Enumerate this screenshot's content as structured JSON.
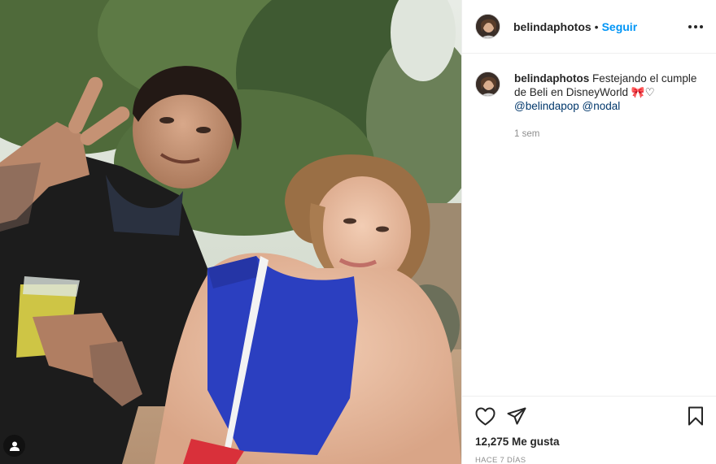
{
  "post": {
    "image_alt": "photo",
    "author": {
      "username": "belindaphotos",
      "separator": "•",
      "follow_label": "Seguir"
    }
  },
  "caption": {
    "username": "belindaphotos",
    "text": "Festejando el cumple de Beli en DisneyWorld 🎀♡",
    "mentions": [
      "@belindapop",
      "@nodal"
    ],
    "age": "1 sem"
  },
  "stats": {
    "likes": "12,275 Me gusta",
    "timestamp": "HACE 7 DÍAS"
  },
  "icons": {
    "like": "heart-icon",
    "share": "paper-plane-icon",
    "save": "bookmark-icon",
    "more": "more-options-icon",
    "tags": "user-tag-icon"
  },
  "colors": {
    "accent": "#0095f6",
    "mention": "#00376b",
    "muted": "#8e8e8e",
    "text": "#262626"
  }
}
